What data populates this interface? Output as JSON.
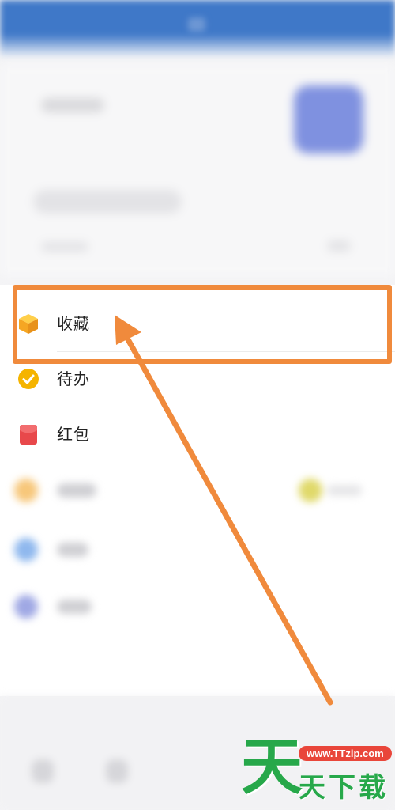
{
  "menu": {
    "items": [
      {
        "label": "收藏",
        "icon": "cube-icon",
        "color": "#f5a623"
      },
      {
        "label": "待办",
        "icon": "check-circle-icon",
        "color": "#f5b400"
      },
      {
        "label": "红包",
        "icon": "red-envelope-icon",
        "color": "#e8484b"
      }
    ]
  },
  "annotation": {
    "highlight_color": "#f08a3c"
  },
  "watermark": {
    "big_char": "天",
    "url": "www.TTzip.com",
    "text": "天下载",
    "brand_green": "#27a84a",
    "badge_red": "#e9463a"
  }
}
